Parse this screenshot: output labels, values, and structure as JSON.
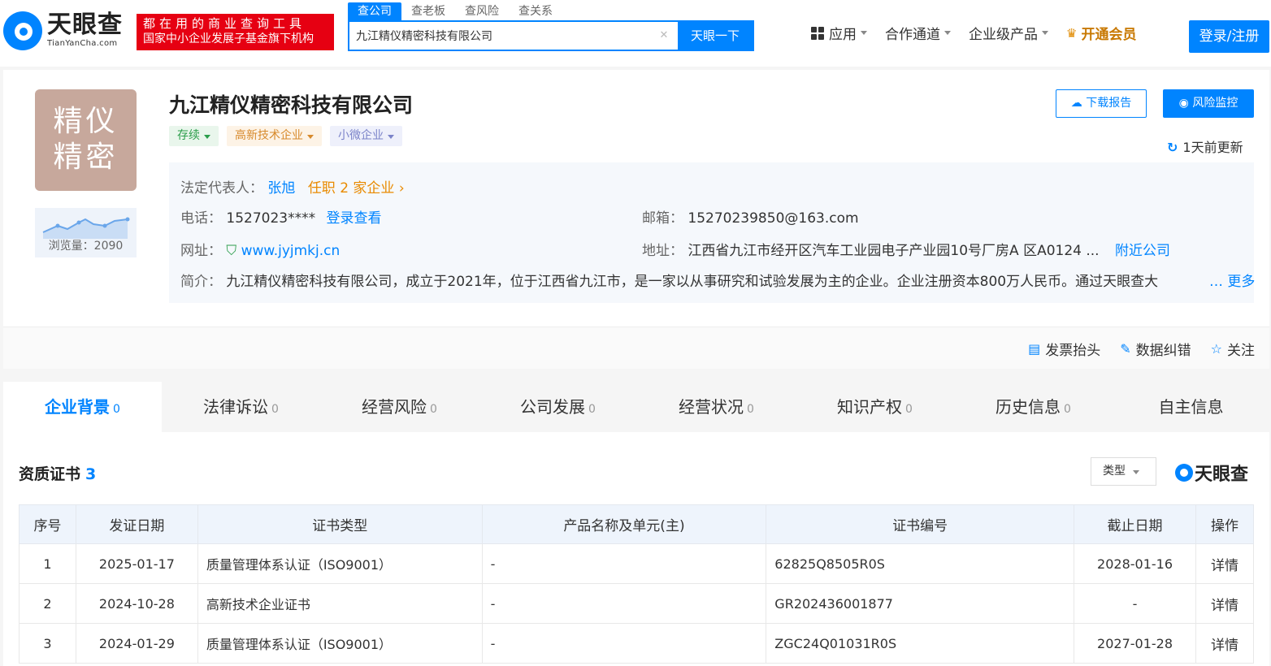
{
  "header": {
    "logo_cn": "天眼查",
    "logo_en": "TianYanCha.com",
    "slogan_line1": "都在用的商业查询工具",
    "slogan_line2": "国家中小企业发展子基金旗下机构",
    "search_tabs": [
      "查公司",
      "查老板",
      "查风险",
      "查关系"
    ],
    "search_value": "九江精仪精密科技有限公司",
    "search_button": "天眼一下",
    "nav": {
      "apps": "应用",
      "channel": "合作通道",
      "enterprise": "企业级产品",
      "vip": "开通会员"
    },
    "login": "登录/注册"
  },
  "company": {
    "logo_line1": "精仪",
    "logo_line2": "精密",
    "views": "浏览量：2090",
    "name": "九江精仪精密科技有限公司",
    "tags": [
      "存续",
      "高新技术企业",
      "小微企业"
    ],
    "download": "下载报告",
    "monitor": "风险监控",
    "updated": "1天前更新",
    "legal_label": "法定代表人：",
    "legal_name": "张旭",
    "legal_orgs": "任职 2 家企业",
    "phone_label": "电话：",
    "phone": "1527023****",
    "phone_link": "登录查看",
    "email_label": "邮箱：",
    "email": "15270239850@163.com",
    "website_label": "网址：",
    "website": "www.jyjmkj.cn",
    "address_label": "地址：",
    "address": "江西省九江市经开区汽车工业园电子产业园10号厂房A 区A0124 ...",
    "nearby": "附近公司",
    "intro_label": "简介：",
    "intro": "九江精仪精密科技有限公司，成立于2021年，位于江西省九江市，是一家以从事研究和试验发展为主的企业。企业注册资本800万人民币。通过天眼查大",
    "more": "更多",
    "ops": [
      "发票抬头",
      "数据纠错",
      "关注"
    ]
  },
  "tabs": [
    {
      "label": "企业背景",
      "count": "0"
    },
    {
      "label": "法律诉讼",
      "count": "0"
    },
    {
      "label": "经营风险",
      "count": "0"
    },
    {
      "label": "公司发展",
      "count": "0"
    },
    {
      "label": "经营状况",
      "count": "0"
    },
    {
      "label": "知识产权",
      "count": "0"
    },
    {
      "label": "历史信息",
      "count": "0"
    },
    {
      "label": "自主信息",
      "count": ""
    }
  ],
  "certs": {
    "title": "资质证书",
    "count": "3",
    "filter": "类型",
    "brand": "天眼查",
    "columns": [
      "序号",
      "发证日期",
      "证书类型",
      "产品名称及单元(主)",
      "证书编号",
      "截止日期",
      "操作"
    ],
    "rows": [
      {
        "no": "1",
        "date": "2025-01-17",
        "type": "质量管理体系认证（ISO9001）",
        "product": "-",
        "code": "62825Q8505R0S",
        "end": "2028-01-16",
        "action": "详情"
      },
      {
        "no": "2",
        "date": "2024-10-28",
        "type": "高新技术企业证书",
        "product": "-",
        "code": "GR202436001877",
        "end": "-",
        "action": "详情"
      },
      {
        "no": "3",
        "date": "2024-01-29",
        "type": "质量管理体系认证（ISO9001）",
        "product": "-",
        "code": "ZGC24Q01031R0S",
        "end": "2027-01-28",
        "action": "详情"
      }
    ]
  }
}
